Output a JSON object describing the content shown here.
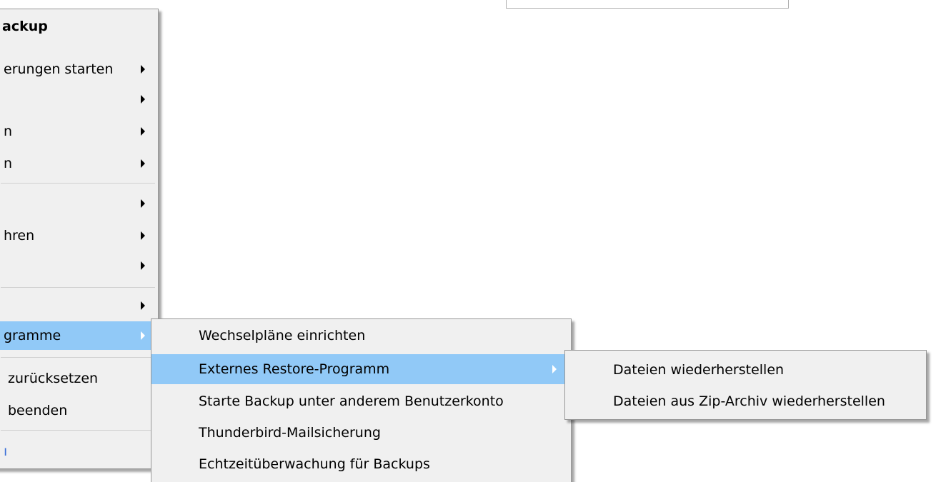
{
  "main_menu": {
    "title": "ackup",
    "items": [
      {
        "label": "erungen starten"
      },
      {
        "label": ""
      },
      {
        "label": "n"
      },
      {
        "label": "n"
      },
      {
        "label": ""
      },
      {
        "label": "hren"
      },
      {
        "label": ""
      },
      {
        "label": ""
      },
      {
        "label": "gramme"
      },
      {
        "label": "zurücksetzen"
      },
      {
        "label": "beenden"
      },
      {
        "label": "ı"
      }
    ]
  },
  "programs_submenu": {
    "items": [
      {
        "label": "Wechselpläne einrichten"
      },
      {
        "label": "Externes Restore-Programm"
      },
      {
        "label": "Starte Backup unter anderem Benutzerkonto"
      },
      {
        "label": "Thunderbird-Mailsicherung"
      },
      {
        "label": "Echtzeitüberwachung für Backups"
      }
    ]
  },
  "restore_submenu": {
    "items": [
      {
        "label": "Dateien wiederherstellen"
      },
      {
        "label": "Dateien aus Zip-Archiv wiederherstellen"
      }
    ]
  },
  "colors": {
    "menu_bg": "#f0f0f0",
    "highlight": "#91c9f7",
    "border": "#979797"
  }
}
